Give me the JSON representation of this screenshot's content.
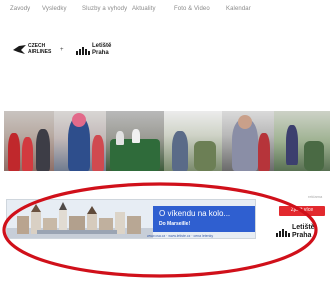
{
  "nav": {
    "items": [
      "Zavody",
      "Vysledky",
      "Sluzby a vyhody",
      "Aktuality",
      "Foto & Video",
      "Kalendar"
    ]
  },
  "logos": {
    "airlines_line1": "CZECH",
    "airlines_line2": "AIRLINES",
    "plus": "+",
    "letiste_line1": "Letiště",
    "letiste_line2": "Praha"
  },
  "banner": {
    "headline": "O víkendu na kolo...",
    "subline": "Do Marseille!",
    "footer": "www.csa.cz · www.letiste.cz · cena letenky",
    "cta_label": "Zjistit více",
    "side_label": "reklama",
    "logo_line1": "Letiště",
    "logo_line2": "Praha"
  },
  "colors": {
    "accent_red": "#e2292e",
    "banner_blue": "#2f5fd0",
    "annotation_red": "#d0101a"
  }
}
